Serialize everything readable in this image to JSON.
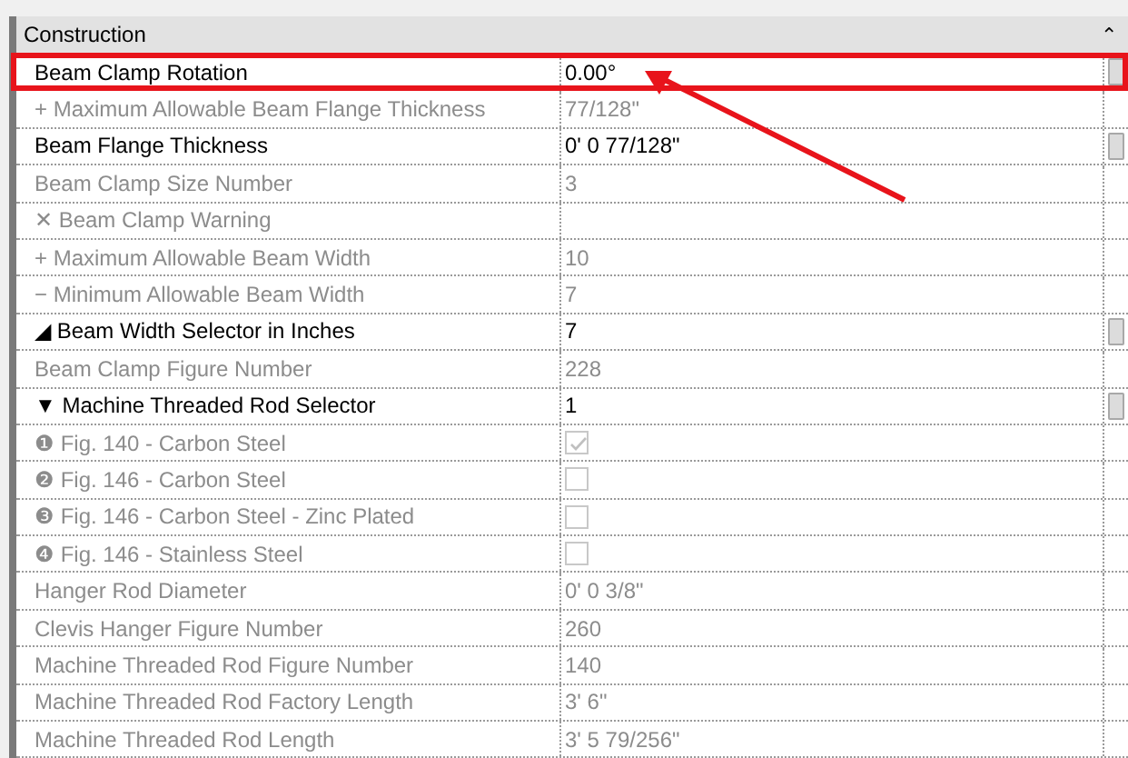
{
  "group": {
    "title": "Construction",
    "collapse_icon": "⌃",
    "expanded": true
  },
  "rows": [
    {
      "label": "Beam Clamp Rotation",
      "kind": "text",
      "value": "0.00°",
      "disabled": false,
      "button": true,
      "highlighted": true
    },
    {
      "label": "+ Maximum Allowable Beam Flange Thickness",
      "kind": "text",
      "value": "77/128\"",
      "disabled": true,
      "button": false,
      "highlighted": false
    },
    {
      "label": "Beam Flange Thickness",
      "kind": "text",
      "value": "0'  0 77/128\"",
      "disabled": false,
      "button": true,
      "highlighted": false
    },
    {
      "label": "Beam Clamp Size Number",
      "kind": "text",
      "value": "3",
      "disabled": true,
      "button": false,
      "highlighted": false
    },
    {
      "label": "✕ Beam Clamp Warning",
      "kind": "text",
      "value": "",
      "disabled": true,
      "button": false,
      "highlighted": false
    },
    {
      "label": "+ Maximum Allowable Beam Width",
      "kind": "text",
      "value": "10",
      "disabled": true,
      "button": false,
      "highlighted": false
    },
    {
      "label": "− Minimum Allowable Beam Width",
      "kind": "text",
      "value": "7",
      "disabled": true,
      "button": false,
      "highlighted": false
    },
    {
      "label": "◢ Beam Width Selector in Inches",
      "kind": "text",
      "value": "7",
      "disabled": false,
      "button": true,
      "highlighted": false
    },
    {
      "label": "Beam Clamp Figure Number",
      "kind": "text",
      "value": "228",
      "disabled": true,
      "button": false,
      "highlighted": false
    },
    {
      "label": "▼ Machine Threaded Rod Selector",
      "kind": "text",
      "value": "1",
      "disabled": false,
      "button": true,
      "highlighted": false
    },
    {
      "label": "❶ Fig. 140 - Carbon Steel",
      "kind": "checkbox",
      "checked": true,
      "disabled": true,
      "button": false,
      "highlighted": false
    },
    {
      "label": "❷ Fig. 146 - Carbon Steel",
      "kind": "checkbox",
      "checked": false,
      "disabled": true,
      "button": false,
      "highlighted": false
    },
    {
      "label": "❸ Fig. 146 - Carbon Steel - Zinc Plated",
      "kind": "checkbox",
      "checked": false,
      "disabled": true,
      "button": false,
      "highlighted": false
    },
    {
      "label": "❹ Fig. 146 - Stainless Steel",
      "kind": "checkbox",
      "checked": false,
      "disabled": true,
      "button": false,
      "highlighted": false
    },
    {
      "label": "Hanger Rod Diameter",
      "kind": "text",
      "value": "0'  0 3/8\"",
      "disabled": true,
      "button": false,
      "highlighted": false
    },
    {
      "label": "Clevis Hanger Figure Number",
      "kind": "text",
      "value": "260",
      "disabled": true,
      "button": false,
      "highlighted": false
    },
    {
      "label": "Machine Threaded Rod Figure Number",
      "kind": "text",
      "value": "140",
      "disabled": true,
      "button": false,
      "highlighted": false
    },
    {
      "label": "Machine Threaded Rod Factory Length",
      "kind": "text",
      "value": "3'  6\"",
      "disabled": true,
      "button": false,
      "highlighted": false
    },
    {
      "label": "Machine Threaded Rod Length",
      "kind": "text",
      "value": "3'  5 79/256\"",
      "disabled": true,
      "button": false,
      "highlighted": false
    }
  ]
}
